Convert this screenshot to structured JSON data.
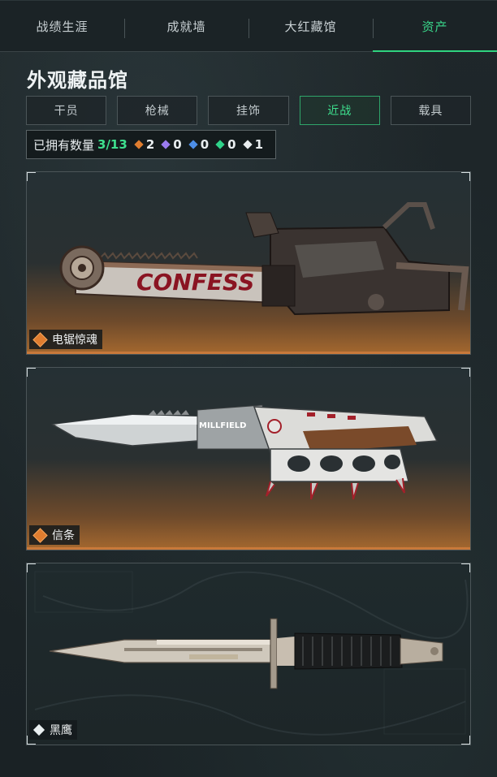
{
  "nav": {
    "tabs": [
      {
        "label": "战绩生涯"
      },
      {
        "label": "成就墙"
      },
      {
        "label": "大红藏馆"
      },
      {
        "label": "资产"
      }
    ],
    "active_index": 3
  },
  "page": {
    "title": "外观藏品馆"
  },
  "categories": {
    "items": [
      {
        "label": "干员"
      },
      {
        "label": "枪械"
      },
      {
        "label": "挂饰"
      },
      {
        "label": "近战"
      },
      {
        "label": "载具"
      }
    ],
    "active_index": 3
  },
  "owned": {
    "label": "已拥有数量",
    "count": "3/13",
    "stats": [
      {
        "icon": "orange-diamond-icon",
        "color": "#e07d2f",
        "value": "2"
      },
      {
        "icon": "purple-diamond-icon",
        "color": "#9b7bf0",
        "value": "0"
      },
      {
        "icon": "blue-diamond-icon",
        "color": "#4d8ee8",
        "value": "0"
      },
      {
        "icon": "green-diamond-icon",
        "color": "#2fd38a",
        "value": "0"
      },
      {
        "icon": "white-diamond-icon",
        "color": "#e9eef0",
        "value": "1"
      }
    ]
  },
  "items": [
    {
      "name": "电锯惊魂",
      "rarity_icon": "orange-diamond-icon",
      "weapon": "chainsaw",
      "blade_text": "CONFESS"
    },
    {
      "name": "信条",
      "rarity_icon": "orange-diamond-icon",
      "weapon": "knuckle-knife",
      "blade_text": "MILLFIELD"
    },
    {
      "name": "黑鹰",
      "rarity_icon": "white-diamond-icon",
      "weapon": "bayonet"
    }
  ],
  "colors": {
    "accent": "#2fd37f",
    "rare_orange": "#e07d2f"
  }
}
